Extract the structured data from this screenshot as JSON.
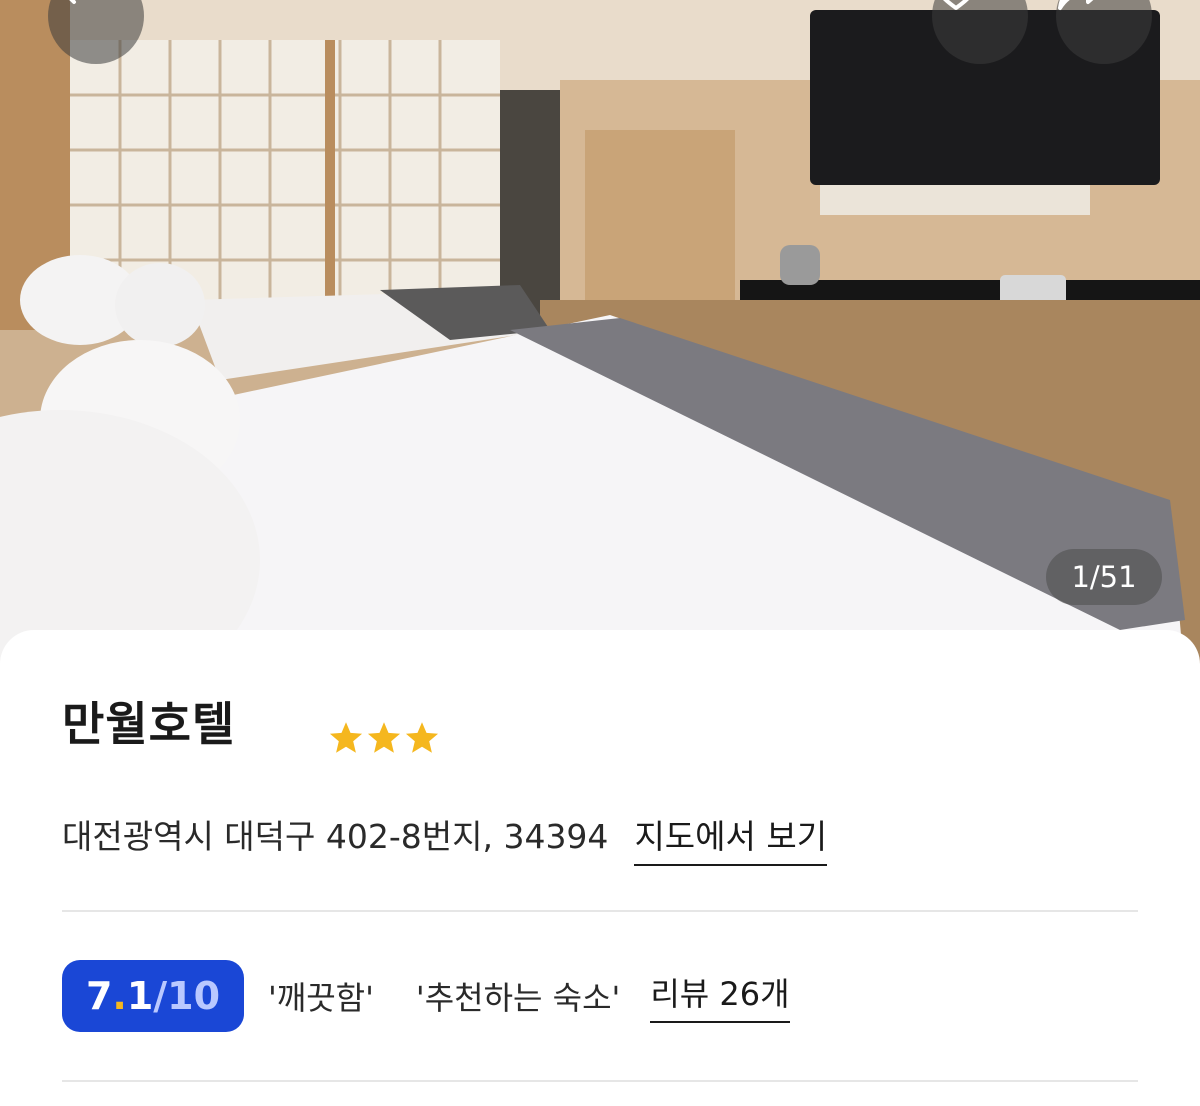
{
  "photo": {
    "counter": "1/51"
  },
  "nav": {
    "back_icon": "chevron-left-icon",
    "like_icon": "heart-icon",
    "share_icon": "share-arrow-icon"
  },
  "hotel": {
    "name": "만월호텔",
    "star_rating": 3,
    "star_color": "#f5b71e",
    "address": "대전광역시 대덕구 402-8번지, 34394",
    "map_link": "지도에서 보기"
  },
  "reviews": {
    "score_main": "7",
    "score_dot": ".",
    "score_decimal": "1",
    "score_max": "/10",
    "badge_color": "#1a47d6",
    "tags": [
      "'깨끗함'",
      "'추천하는 숙소'"
    ],
    "review_link": "리뷰 26개"
  }
}
